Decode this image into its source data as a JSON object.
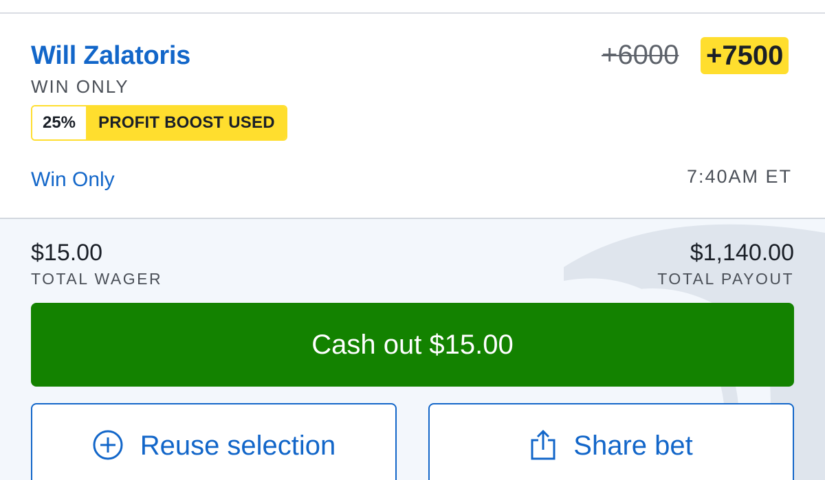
{
  "selection": {
    "player_name": "Will Zalatoris",
    "market_type": "WIN ONLY",
    "boost": {
      "percent": "25%",
      "label": "PROFIT BOOST USED"
    },
    "original_odds": "+6000",
    "boosted_odds": "+7500",
    "market_link": "Win Only",
    "start_time": "7:40AM ET"
  },
  "summary": {
    "wager_value": "$15.00",
    "wager_label": "TOTAL WAGER",
    "payout_value": "$1,140.00",
    "payout_label": "TOTAL PAYOUT"
  },
  "actions": {
    "cashout_label": "Cash out $15.00",
    "reuse_label": "Reuse selection",
    "share_label": "Share bet"
  },
  "icons": {
    "reuse": "plus-circle-icon",
    "share": "share-icon"
  },
  "colors": {
    "brand_blue": "#1266c9",
    "boost_yellow": "#ffde2e",
    "cashout_green": "#138200",
    "footer_bg": "#f3f7fc"
  }
}
